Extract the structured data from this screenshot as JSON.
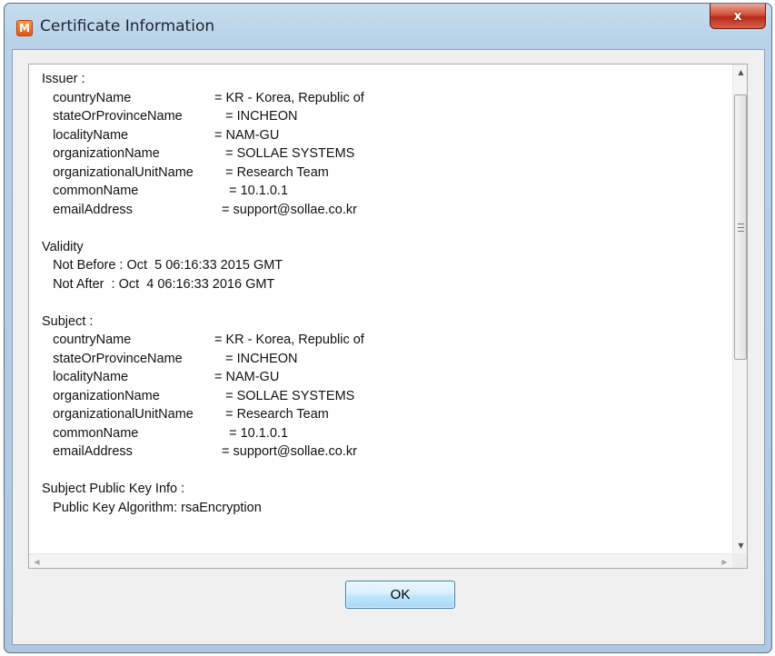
{
  "window": {
    "title": "Certificate Information",
    "app_icon_letter": "M",
    "close_symbol": "x"
  },
  "lines": [
    {
      "k": "Issuer :",
      "v": ""
    },
    {
      "k": "   countryName",
      "v": "= KR - Korea, Republic of"
    },
    {
      "k": "   stateOrProvinceName",
      "v": "   = INCHEON"
    },
    {
      "k": "   localityName",
      "v": "= NAM-GU"
    },
    {
      "k": "   organizationName",
      "v": "   = SOLLAE SYSTEMS"
    },
    {
      "k": "   organizationalUnitName",
      "v": "   = Research Team"
    },
    {
      "k": "   commonName",
      "v": "    = 10.1.0.1"
    },
    {
      "k": "   emailAddress",
      "v": "  = support@sollae.co.kr"
    },
    {
      "k": "",
      "v": ""
    },
    {
      "k": "Validity",
      "v": ""
    },
    {
      "k": "   Not Before : Oct  5 06:16:33 2015 GMT",
      "v": ""
    },
    {
      "k": "   Not After  : Oct  4 06:16:33 2016 GMT",
      "v": ""
    },
    {
      "k": "",
      "v": ""
    },
    {
      "k": "Subject :",
      "v": ""
    },
    {
      "k": "   countryName",
      "v": "= KR - Korea, Republic of"
    },
    {
      "k": "   stateOrProvinceName",
      "v": "   = INCHEON"
    },
    {
      "k": "   localityName",
      "v": "= NAM-GU"
    },
    {
      "k": "   organizationName",
      "v": "   = SOLLAE SYSTEMS"
    },
    {
      "k": "   organizationalUnitName",
      "v": "   = Research Team"
    },
    {
      "k": "   commonName",
      "v": "    = 10.1.0.1"
    },
    {
      "k": "   emailAddress",
      "v": "  = support@sollae.co.kr"
    },
    {
      "k": "",
      "v": ""
    },
    {
      "k": "Subject Public Key Info :",
      "v": ""
    },
    {
      "k": "   Public Key Algorithm: rsaEncryption",
      "v": ""
    }
  ],
  "buttons": {
    "ok_label": "OK"
  }
}
